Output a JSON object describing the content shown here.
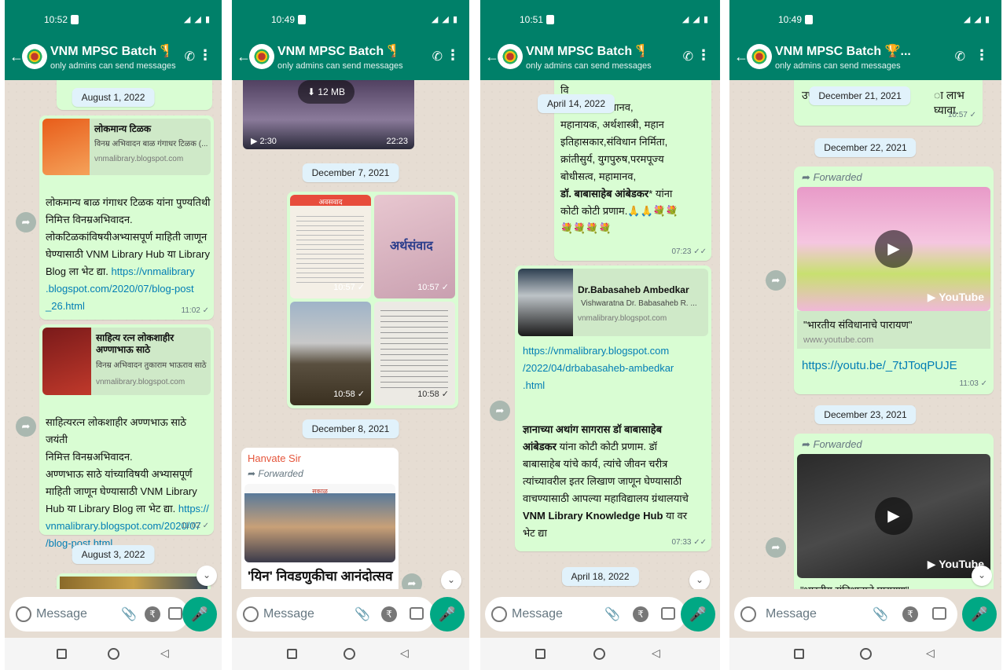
{
  "chat": {
    "title": "VNM MPSC Batch 🏆...",
    "subtitle": "only admins can send messages"
  },
  "screens": [
    {
      "time": "10:52",
      "dates": [
        "August 1, 2022",
        "August 3, 2022"
      ],
      "previews": [
        {
          "title": "लोकमान्य टिळक",
          "desc": "विनम्र अभिवादन बाळ गंगाधर टिळक (...",
          "url": "vnmalibrary.blogspot.com"
        },
        {
          "title": "साहित्य रत्न लोकशाहीर अण्णाभाऊ साठे",
          "desc": "विनम्र अभिवादन तुकाराम भाऊराव साठे ...",
          "url": "vnmalibrary.blogspot.com"
        }
      ],
      "msg1": [
        "लोकमान्य बाळ गंगाधर टिळक यांना पुण्यतिथी",
        "निमित्त विनम्रअभिवादन.",
        "लोकटिळकांविषयीअभ्यासपूर्ण माहिती जाणून",
        "घेण्यासाठी VNM Library Hub या Library",
        "Blog ला भेट द्या."
      ],
      "msg1_link": [
        "https://vnmalibrary",
        ".blogspot.com/2020/07/blog-post",
        "_26.html"
      ],
      "msg1_time": "11:02 ✓",
      "msg2": [
        "साहित्यरत्न लोकशाहीर अण्णभाऊ साठे जयंती",
        "निमित्त विनम्रअभिवादन.",
        "अण्णभाऊ साठे यांच्याविषयी अभ्यासपूर्ण",
        "माहिती जाणून घेण्यासाठी VNM Library",
        "Hub या Library Blog ला भेट द्या."
      ],
      "msg2_link": [
        "https://",
        "vnmalibrary.blogspot.com/2020/07",
        "/blog-post.html"
      ],
      "msg2_time": "11:02 ✓"
    },
    {
      "time": "10:49",
      "video_size": "12 MB",
      "video_len": "2:30",
      "video_time": "22:23",
      "dates": [
        "December 7, 2021",
        "December 8, 2021"
      ],
      "grid_times": [
        "10:57 ✓",
        "10:57 ✓",
        "10:58 ✓",
        "10:58 ✓"
      ],
      "sender": "Hanvate Sir",
      "forwarded": "Forwarded",
      "news_headline": "'यिन' निवडणुकीचा आनंदोत्सव",
      "paper_name": "अवसवाद",
      "paper_mast": "सकाळ"
    },
    {
      "time": "10:51",
      "dates": [
        "April 14, 2022",
        "April 18, 2022"
      ],
      "msg1": [
        "वि",
        "भारतरत्न,महामानव,",
        "महानायक, अर्थशास्त्री, महान",
        "इतिहासकार,संविधान निर्मिता,",
        "क्रांतीसुर्य, युगपुरुष,परमपूज्य",
        "बोधीसत्व, महामानव,"
      ],
      "msg1_bold": "डॉ. बाबासाहेब आंबेडकर",
      "msg1_rest": "* यांना",
      "msg1_end": "कोटी कोटी प्रणाम.🙏🙏💐💐",
      "msg1_flowers": "💐💐💐💐",
      "msg1_time": "07:23 ✓✓",
      "preview": {
        "title": "Dr.Babasaheb Ambedkar",
        "desc": "Vishwaratna Dr. Babasaheb R. ...",
        "url": "vnmalibrary.blogspot.com"
      },
      "link": [
        "https://vnmalibrary.blogspot.com",
        "/2022/04/drbabasaheb-ambedkar",
        ".html"
      ],
      "msg2_bold1": "ज्ञानाच्या अथांग सागरास डॉ बाबासाहेब",
      "msg2_bold2": "आंबेडकर",
      "msg2_l2": " यांना कोटी कोटी प्रणाम. डॉ",
      "msg2": [
        "बाबासाहेब यांचे कार्य, त्यांचे जीवन चरीत्र",
        "त्यांच्यावरील इतर लिखाण जाणून घेण्यासाठी",
        "वाचण्यासाठी आपल्या महाविद्यालय ग्रंथालयाचे"
      ],
      "msg2_bold3": "VNM Library Knowledge Hub",
      "msg2_l6": " या वर",
      "msg2_l7": "भेट द्या",
      "msg2_time": "07:33 ✓✓"
    },
    {
      "time": "10:49",
      "dates": [
        "December 21, 2021",
        "December 22, 2021",
        "December 23, 2021"
      ],
      "top_text": "उपस्थित",
      "top_text2": "ा लाभ घ्यावा.",
      "top_time": "10:57 ✓",
      "forwarded": "Forwarded",
      "yt_brand": "YouTube",
      "yt_title": "\"भारतीय संविधानाचे पारायण\"",
      "yt_url": "www.youtube.com",
      "yt_link": "https://youtu.be/_7tJToqPUJE",
      "yt_time": "11:03 ✓"
    }
  ],
  "input": {
    "placeholder": "Message"
  }
}
